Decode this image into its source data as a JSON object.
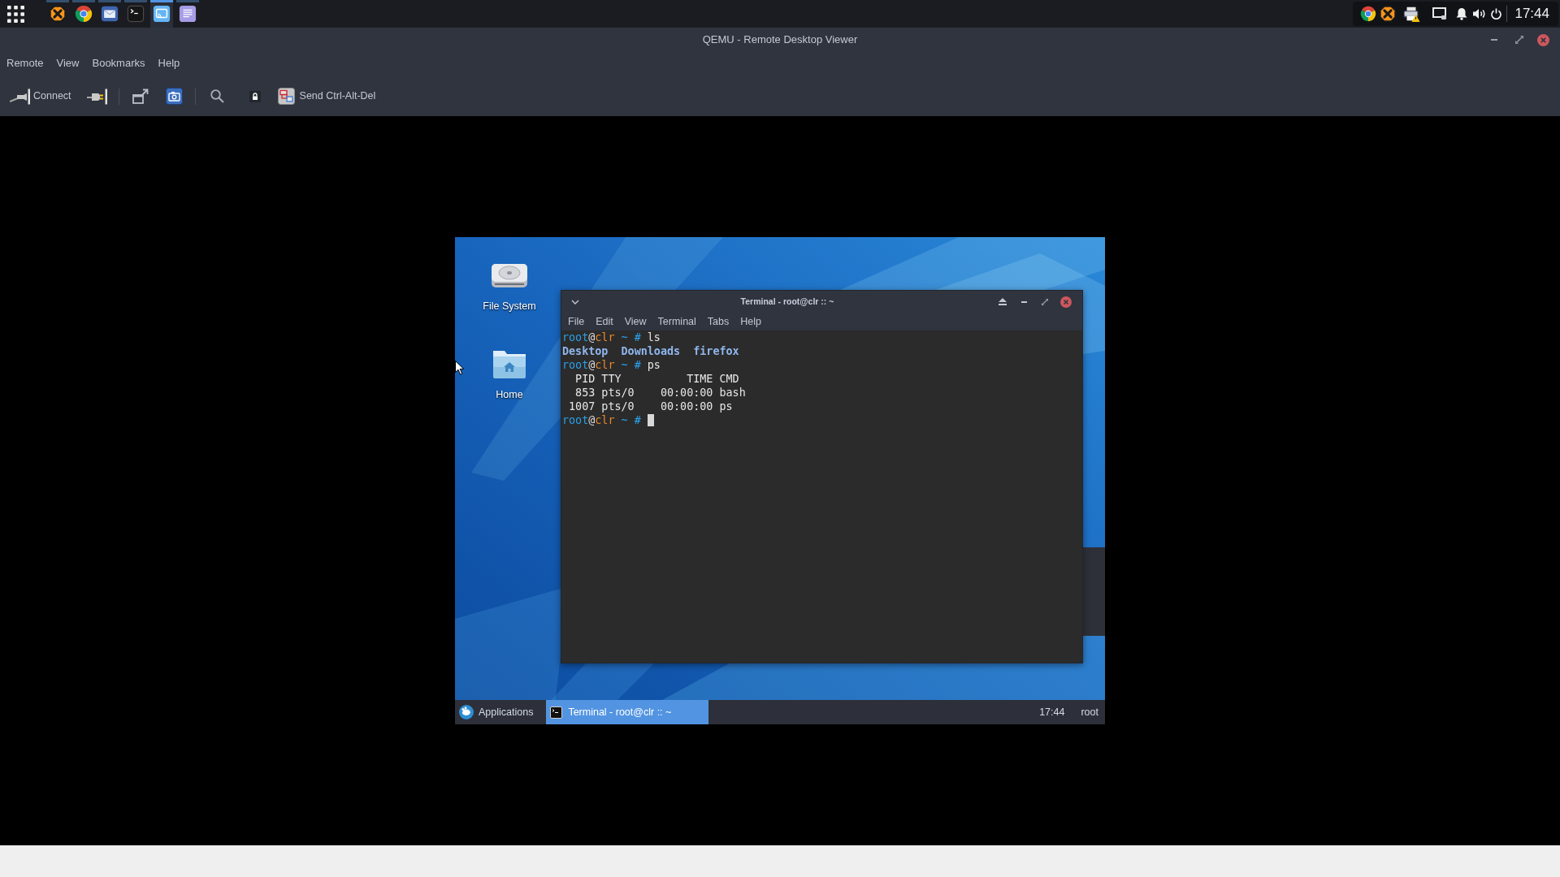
{
  "top_panel": {
    "apps": [
      {
        "kind": "xsplit",
        "running": true,
        "selected": false
      },
      {
        "kind": "chrome",
        "running": true,
        "selected": false
      },
      {
        "kind": "mail",
        "running": true,
        "selected": false
      },
      {
        "kind": "terminal",
        "running": true,
        "selected": false
      },
      {
        "kind": "remote-viewer",
        "running": true,
        "selected": true
      },
      {
        "kind": "notes",
        "running": true,
        "selected": false
      }
    ],
    "tray": [
      {
        "kind": "chrome"
      },
      {
        "kind": "xsplit"
      },
      {
        "kind": "printer-warning"
      },
      {
        "kind": "display"
      },
      {
        "kind": "notifications"
      },
      {
        "kind": "volume"
      },
      {
        "kind": "power"
      }
    ],
    "clock": "17:44"
  },
  "window": {
    "title": "QEMU - Remote Desktop Viewer"
  },
  "menu": [
    "Remote",
    "View",
    "Bookmarks",
    "Help"
  ],
  "toolbar": [
    {
      "kind": "connect",
      "label": "Connect"
    },
    {
      "kind": "disconnect"
    },
    {
      "kind": "separator"
    },
    {
      "kind": "fullscreen"
    },
    {
      "kind": "screenshot"
    },
    {
      "kind": "separator"
    },
    {
      "kind": "zoom"
    },
    {
      "kind": "lock"
    },
    {
      "kind": "send-keys",
      "label": "Send Ctrl-Alt-Del"
    }
  ],
  "remote_screen": {
    "desktop_icons": [
      {
        "kind": "drive",
        "label": "File System"
      },
      {
        "kind": "home-folder",
        "label": "Home"
      }
    ],
    "terminal": {
      "title": "Terminal - root@clr :: ~",
      "menu": [
        "File",
        "Edit",
        "View",
        "Terminal",
        "Tabs",
        "Help"
      ],
      "lines": [
        {
          "kind": "prompt",
          "user": "root",
          "at": "@",
          "host": "clr",
          "path": "~",
          "symbol": "#",
          "command": "ls"
        },
        {
          "kind": "listing",
          "entries": [
            "Desktop",
            "Downloads",
            "firefox"
          ]
        },
        {
          "kind": "prompt",
          "user": "root",
          "at": "@",
          "host": "clr",
          "path": "~",
          "symbol": "#",
          "command": "ps"
        },
        {
          "kind": "output",
          "text": "  PID TTY          TIME CMD"
        },
        {
          "kind": "output",
          "text": "  853 pts/0    00:00:00 bash"
        },
        {
          "kind": "output",
          "text": " 1007 pts/0    00:00:00 ps"
        },
        {
          "kind": "prompt",
          "user": "root",
          "at": "@",
          "host": "clr",
          "path": "~",
          "symbol": "#",
          "cursor": true
        }
      ]
    },
    "taskbar": {
      "applications_label": "Applications",
      "tasks": [
        {
          "label": "Terminal - root@clr :: ~",
          "selected": true
        }
      ],
      "clock": "17:44",
      "user": "root"
    }
  }
}
